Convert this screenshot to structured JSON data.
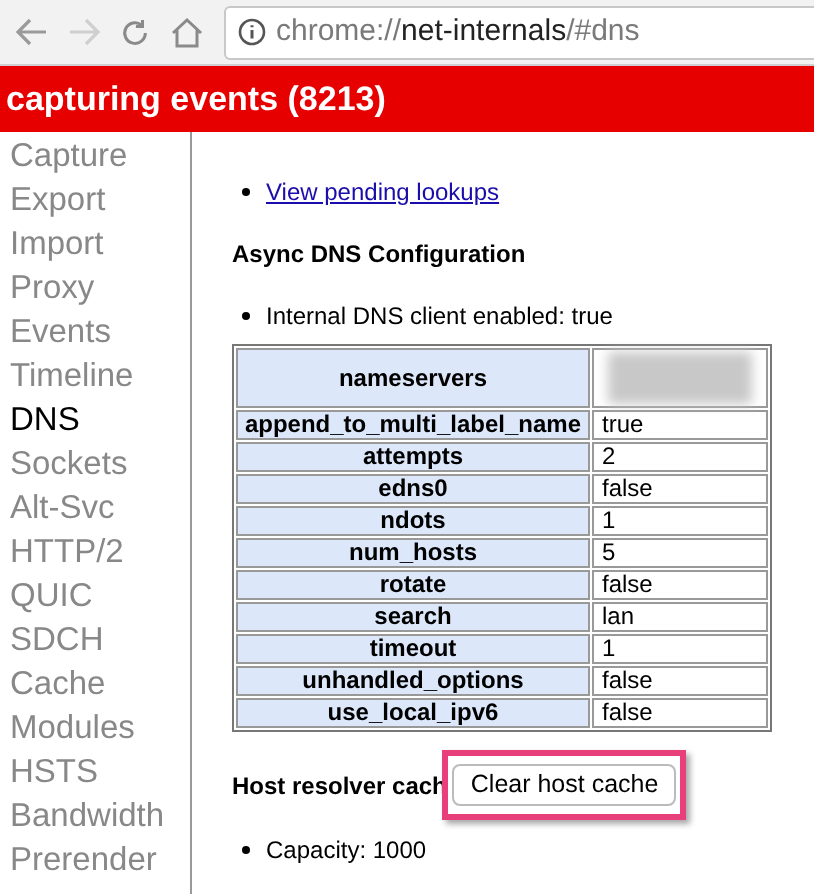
{
  "toolbar": {
    "address": {
      "scheme": "chrome://",
      "host": "net-internals",
      "path": "/#dns"
    }
  },
  "banner": {
    "text": "capturing events (8213)"
  },
  "sidebar": {
    "items": [
      {
        "label": "Capture",
        "selected": false
      },
      {
        "label": "Export",
        "selected": false
      },
      {
        "label": "Import",
        "selected": false
      },
      {
        "label": "Proxy",
        "selected": false
      },
      {
        "label": "Events",
        "selected": false
      },
      {
        "label": "Timeline",
        "selected": false
      },
      {
        "label": "DNS",
        "selected": true
      },
      {
        "label": "Sockets",
        "selected": false
      },
      {
        "label": "Alt-Svc",
        "selected": false
      },
      {
        "label": "HTTP/2",
        "selected": false
      },
      {
        "label": "QUIC",
        "selected": false
      },
      {
        "label": "SDCH",
        "selected": false
      },
      {
        "label": "Cache",
        "selected": false
      },
      {
        "label": "Modules",
        "selected": false
      },
      {
        "label": "HSTS",
        "selected": false
      },
      {
        "label": "Bandwidth",
        "selected": false
      },
      {
        "label": "Prerender",
        "selected": false
      }
    ]
  },
  "content": {
    "pending_link": "View pending lookups",
    "async_heading": "Async DNS Configuration",
    "internal_client": "Internal DNS client enabled: true",
    "table": {
      "rows": [
        {
          "key": "nameservers",
          "value": "",
          "kind": "blurred"
        },
        {
          "key": "append_to_multi_label_name",
          "value": "true",
          "kind": "text"
        },
        {
          "key": "attempts",
          "value": "2",
          "kind": "text"
        },
        {
          "key": "edns0",
          "value": "false",
          "kind": "text"
        },
        {
          "key": "ndots",
          "value": "1",
          "kind": "text"
        },
        {
          "key": "num_hosts",
          "value": "5",
          "kind": "text"
        },
        {
          "key": "rotate",
          "value": "false",
          "kind": "text"
        },
        {
          "key": "search",
          "value": "lan",
          "kind": "text"
        },
        {
          "key": "timeout",
          "value": "1",
          "kind": "text"
        },
        {
          "key": "unhandled_options",
          "value": "false",
          "kind": "text"
        },
        {
          "key": "use_local_ipv6",
          "value": "false",
          "kind": "text"
        }
      ]
    },
    "cache_heading": "Host resolver cach",
    "clear_button": "Clear host cache",
    "capacity": "Capacity: 1000"
  }
}
